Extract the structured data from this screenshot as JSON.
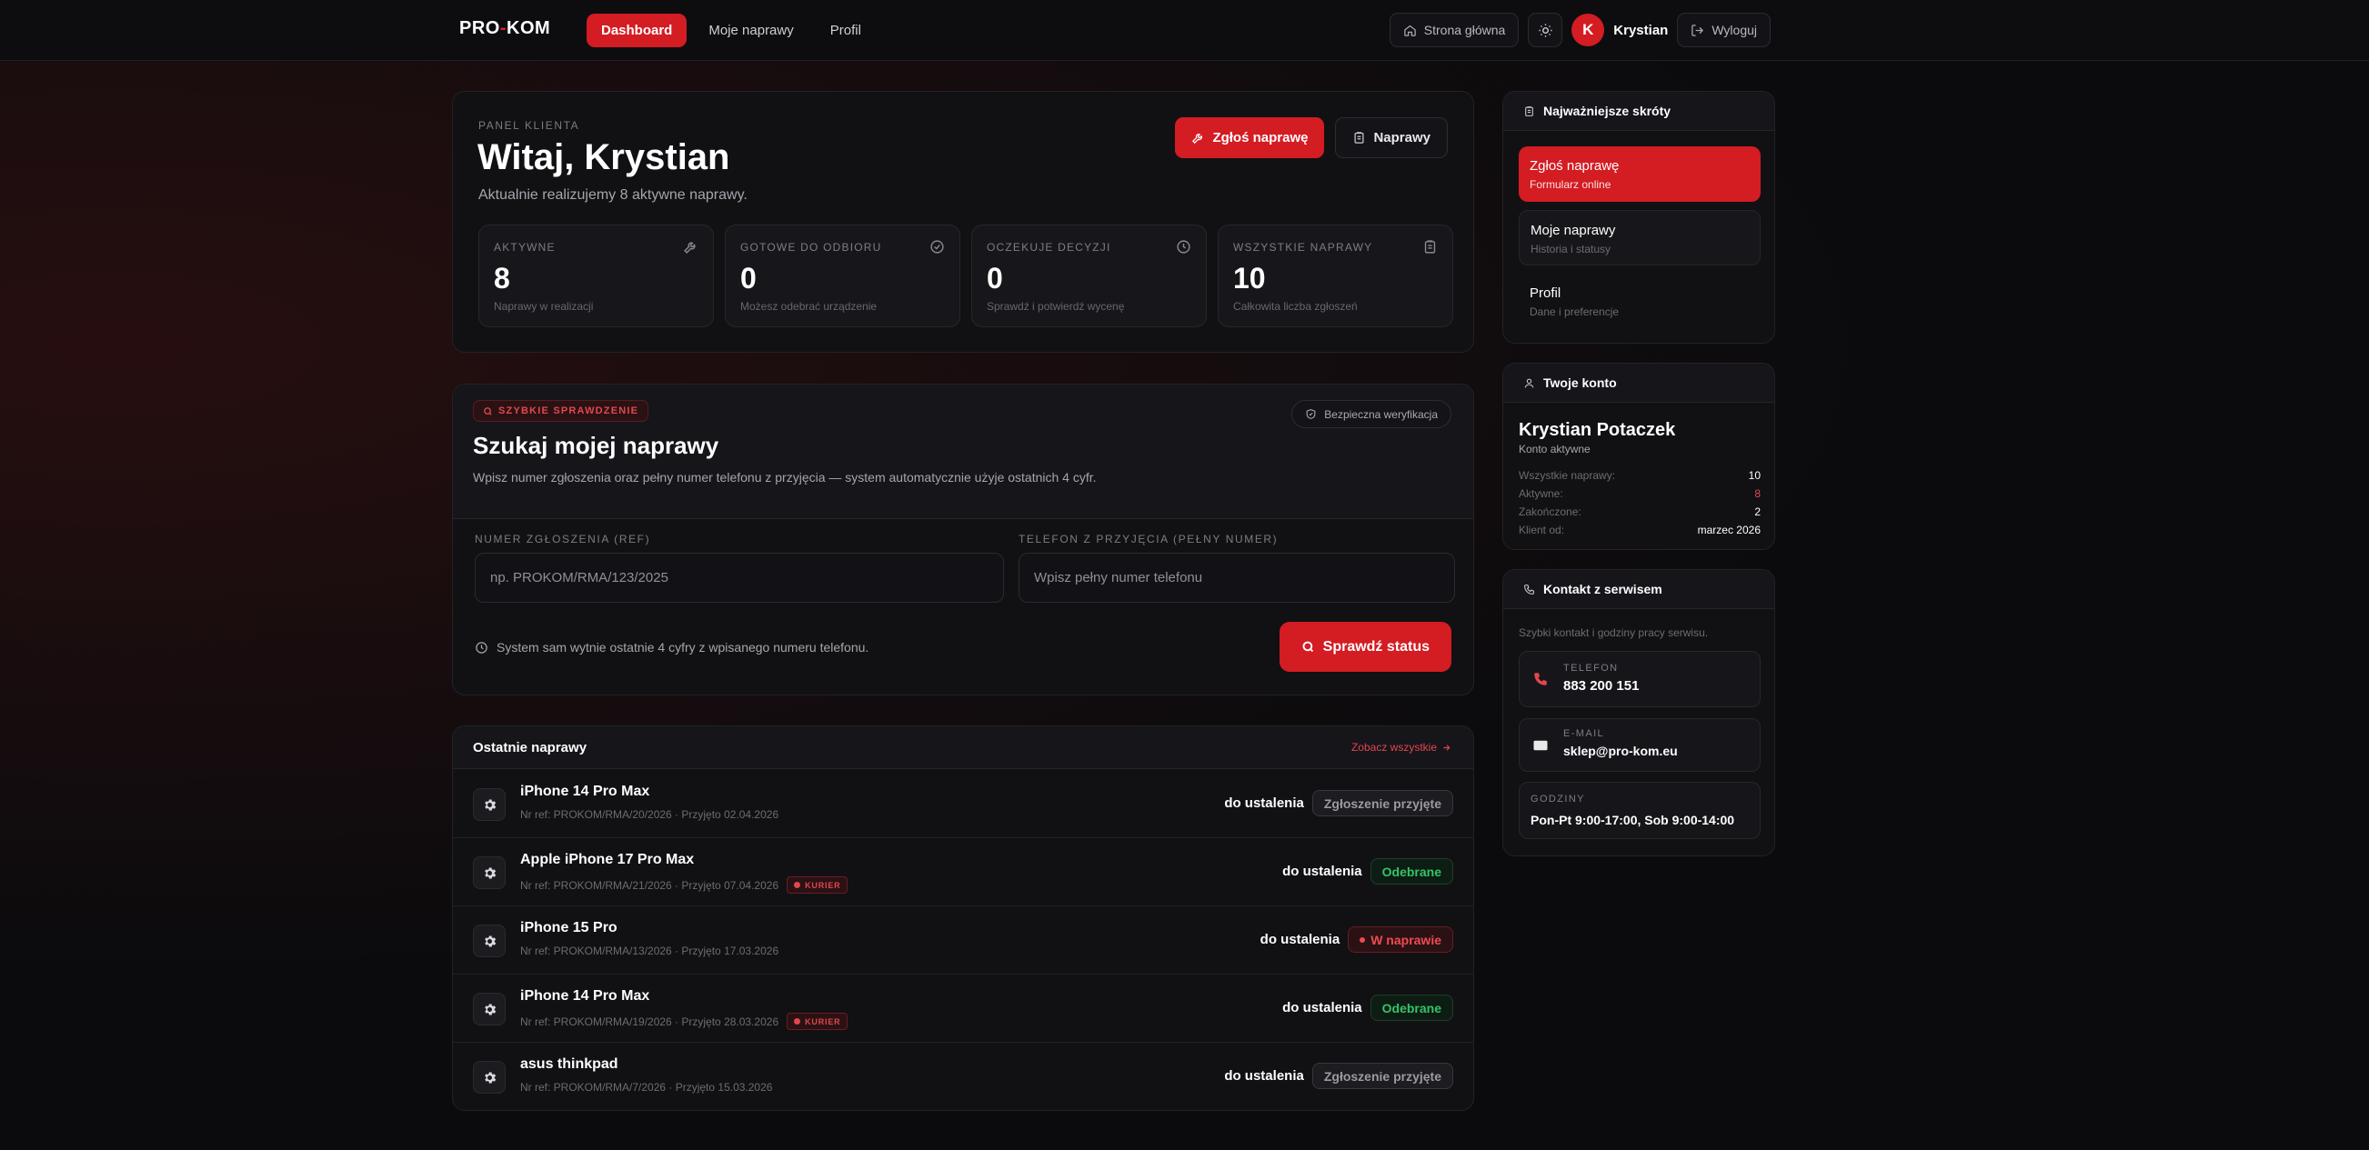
{
  "header": {
    "logo_left": "PRO",
    "logo_dash": "-",
    "logo_right": "KOM",
    "nav": [
      {
        "label": "Dashboard",
        "active": true
      },
      {
        "label": "Moje naprawy",
        "active": false
      },
      {
        "label": "Profil",
        "active": false
      }
    ],
    "home_label": "Strona główna",
    "avatar_initial": "K",
    "user_name": "Krystian",
    "logout_label": "Wyloguj"
  },
  "welcome": {
    "eyebrow": "PANEL KLIENTA",
    "title": "Witaj, Krystian",
    "subtitle": "Aktualnie realizujemy 8 aktywne naprawy.",
    "report_button": "Zgłoś naprawę",
    "repairs_button": "Naprawy",
    "stats": [
      {
        "label": "AKTYWNE",
        "value": "8",
        "note": "Naprawy w realizacji",
        "icon": "wrench-icon"
      },
      {
        "label": "GOTOWE DO ODBIORU",
        "value": "0",
        "note": "Możesz odebrać urządzenie",
        "icon": "check-circle-icon"
      },
      {
        "label": "OCZEKUJE DECYZJI",
        "value": "0",
        "note": "Sprawdź i potwierdź wycenę",
        "icon": "clock-icon"
      },
      {
        "label": "WSZYSTKIE NAPRAWY",
        "value": "10",
        "note": "Całkowita liczba zgłoszeń",
        "icon": "clipboard-icon"
      }
    ]
  },
  "search": {
    "badge": "SZYBKIE SPRAWDZENIE",
    "secure_label": "Bezpieczna weryfikacja",
    "title": "Szukaj mojej naprawy",
    "description": "Wpisz numer zgłoszenia oraz pełny numer telefonu z przyjęcia — system automatycznie użyje ostatnich 4 cyfr.",
    "ref_label": "NUMER ZGŁOSZENIA (REF)",
    "ref_placeholder": "np. PROKOM/RMA/123/2025",
    "phone_label": "TELEFON Z PRZYJĘCIA (PEŁNY NUMER)",
    "phone_placeholder": "Wpisz pełny numer telefonu",
    "hint": "System sam wytnie ostatnie 4 cyfry z wpisanego numeru telefonu.",
    "button": "Sprawdź status"
  },
  "recent": {
    "title": "Ostatnie naprawy",
    "see_all": "Zobacz wszystkie",
    "rows": [
      {
        "name": "iPhone 14 Pro Max",
        "meta": "Nr ref: PROKOM/RMA/20/2026 · Przyjęto 02.04.2026",
        "courier": false,
        "price": "do ustalenia",
        "status": "Zgłoszenie przyjęte",
        "tone": "gray"
      },
      {
        "name": "Apple iPhone 17 Pro Max",
        "meta": "Nr ref: PROKOM/RMA/21/2026 · Przyjęto 07.04.2026",
        "courier": true,
        "price": "do ustalenia",
        "status": "Odebrane",
        "tone": "green"
      },
      {
        "name": "iPhone 15 Pro",
        "meta": "Nr ref: PROKOM/RMA/13/2026 · Przyjęto 17.03.2026",
        "courier": false,
        "price": "do ustalenia",
        "status": "W naprawie",
        "tone": "red"
      },
      {
        "name": "iPhone 14 Pro Max",
        "meta": "Nr ref: PROKOM/RMA/19/2026 · Przyjęto 28.03.2026",
        "courier": true,
        "price": "do ustalenia",
        "status": "Odebrane",
        "tone": "green"
      },
      {
        "name": "asus thinkpad",
        "meta": "Nr ref: PROKOM/RMA/7/2026 · Przyjęto 15.03.2026",
        "courier": false,
        "price": "do ustalenia",
        "status": "Zgłoszenie przyjęte",
        "tone": "gray"
      }
    ],
    "courier_label": "KURIER"
  },
  "sidebar": {
    "shortcuts": {
      "title": "Najważniejsze skróty",
      "items": [
        {
          "title": "Zgłoś naprawę",
          "sub": "Formularz online"
        },
        {
          "title": "Moje naprawy",
          "sub": "Historia i statusy"
        },
        {
          "title": "Profil",
          "sub": "Dane i preferencje"
        }
      ]
    },
    "account": {
      "title": "Twoje konto",
      "name": "Krystian Potaczek",
      "status": "Konto aktywne",
      "rows": [
        {
          "label": "Wszystkie naprawy:",
          "value": "10"
        },
        {
          "label": "Aktywne:",
          "value": "8"
        },
        {
          "label": "Zakończone:",
          "value": "2"
        },
        {
          "label": "Klient od:",
          "value": "marzec 2026"
        }
      ]
    },
    "contact": {
      "title": "Kontakt z serwisem",
      "description": "Szybki kontakt i godziny pracy serwisu.",
      "phone_label": "TELEFON",
      "phone": "883 200 151",
      "email_label": "E-MAIL",
      "email": "sklep@pro-kom.eu",
      "hours_label": "GODZINY",
      "hours": "Pon-Pt 9:00-17:00, Sob 9:00-14:00"
    }
  },
  "colors": {
    "accent": "#d41c23",
    "success": "#35c36a",
    "background": "#0b0b0d"
  }
}
